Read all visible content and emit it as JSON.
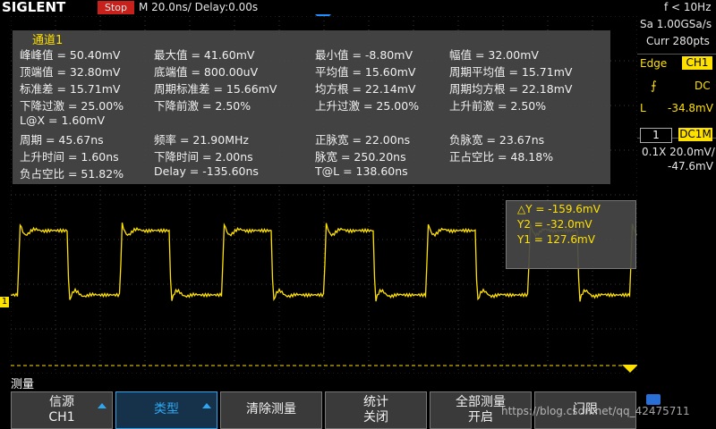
{
  "header": {
    "brand": "SIGLENT",
    "status": "Stop",
    "timebase": "M 20.0ns/  Delay:0.00s",
    "freq_counter": "f < 10Hz"
  },
  "acquisition": {
    "sample_rate": "Sa 1.00GSa/s",
    "curr_points": "Curr 280pts"
  },
  "trigger": {
    "type": "Edge",
    "source": "CH1",
    "coupling": "DC",
    "level_label": "L",
    "level": "-34.8mV"
  },
  "channel": {
    "number": "1",
    "coupling": "DC1M",
    "probe_scale": "0.1X 20.0mV/",
    "offset": "-47.6mV"
  },
  "measurements": {
    "title": "通道1",
    "rows": [
      [
        "峰峰值 = 50.40mV",
        "最大值 = 41.60mV",
        "最小值 = -8.80mV",
        "幅值 = 32.00mV"
      ],
      [
        "顶端值 = 32.80mV",
        "底端值 = 800.00uV",
        "平均值 = 15.60mV",
        "周期平均值 = 15.71mV"
      ],
      [
        "标准差 = 15.71mV",
        "周期标准差 = 15.66mV",
        "均方根 = 22.14mV",
        "周期均方根 = 22.18mV"
      ],
      [
        "下降过激 = 25.00%",
        "下降前激 = 2.50%",
        "上升过激 = 25.00%",
        "上升前激 = 2.50%"
      ],
      [
        "L@X = 1.60mV",
        "",
        "",
        ""
      ],
      [
        "周期 = 45.67ns",
        "频率 = 21.90MHz",
        "正脉宽 = 22.00ns",
        "负脉宽 = 23.67ns"
      ],
      [
        "上升时间 = 1.60ns",
        "下降时间 = 2.00ns",
        "脉宽 = 250.20ns",
        "正占空比 = 48.18%"
      ],
      [
        "负占空比 = 51.82%",
        "Delay = -135.60ns",
        "T@L = 138.60ns",
        ""
      ]
    ]
  },
  "cursors": {
    "delta_y": "△Y = -159.6mV",
    "y2": "Y2 = -32.0mV",
    "y1": "Y1 = 127.6mV"
  },
  "channel_marker": "1",
  "menu": {
    "title": "测量",
    "buttons": [
      {
        "line1": "信源",
        "line2": "CH1",
        "selected": false,
        "arrow": true
      },
      {
        "line1": "类型",
        "line2": "",
        "selected": true,
        "arrow": true
      },
      {
        "line1": "清除测量",
        "line2": "",
        "selected": false,
        "arrow": false
      },
      {
        "line1": "统计",
        "line2": "关闭",
        "selected": false,
        "arrow": false
      },
      {
        "line1": "全部测量",
        "line2": "开启",
        "selected": false,
        "arrow": false
      },
      {
        "line1": "门限",
        "line2": "",
        "selected": false,
        "arrow": false
      }
    ]
  },
  "watermark": "https://blog.csdn.net/qq_42475711",
  "colors": {
    "ch1": "#ffe100",
    "accent": "#2ea7f0",
    "stop": "#c8201b"
  }
}
